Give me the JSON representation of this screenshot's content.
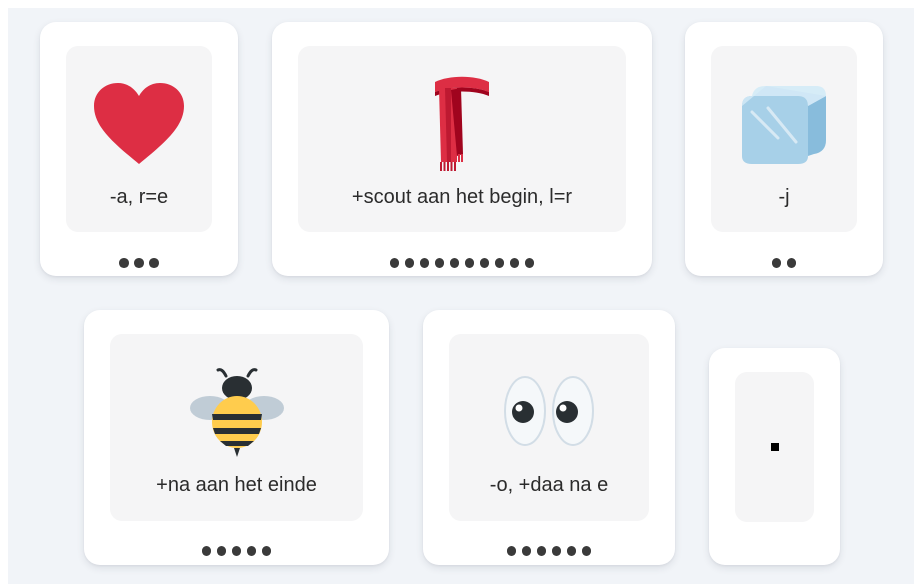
{
  "puzzle": {
    "cards": [
      {
        "id": "card-1",
        "icon": "heart-icon",
        "clue": "-a, r=e",
        "letters": 3
      },
      {
        "id": "card-2",
        "icon": "scarf-icon",
        "clue": "+scout aan het begin, l=r",
        "letters": 10
      },
      {
        "id": "card-3",
        "icon": "ice-cube-icon",
        "clue": "-j",
        "letters": 2
      },
      {
        "id": "card-4",
        "icon": "bee-icon",
        "clue": "+na aan het einde",
        "letters": 5
      },
      {
        "id": "card-5",
        "icon": "eyes-icon",
        "clue": "-o, +daa na e",
        "letters": 6
      },
      {
        "id": "card-6",
        "icon": "period-mark",
        "clue": "",
        "letters": 0
      }
    ]
  },
  "colors": {
    "background": "#f1f4f8",
    "card": "#ffffff",
    "inner": "#f5f5f6",
    "dot": "#3a3a3a",
    "heart": "#dd2e44",
    "scarf": "#dd2e44",
    "ice": "#a7d0e8",
    "bee_stripe": "#ffcc4d"
  }
}
